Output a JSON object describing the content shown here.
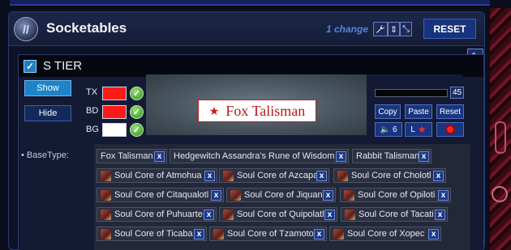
{
  "header": {
    "title": "Socketables",
    "changes": "1 change",
    "reset_label": "RESET"
  },
  "tier": {
    "name": "S TIER",
    "show_label": "Show",
    "hide_label": "Hide"
  },
  "colors": {
    "text_label": "TX",
    "text_color": "#ff1a1a",
    "border_label": "BD",
    "border_color": "#ff1a1a",
    "background_label": "BG",
    "background_color": "#ffffff"
  },
  "preview": {
    "item_name": "Fox Talisman"
  },
  "controls": {
    "font_size": "45",
    "copy_label": "Copy",
    "paste_label": "Paste",
    "reset_label": "Reset",
    "sound_value": "6",
    "minimap_label": "L",
    "sound_icon": "speaker-icon",
    "minimap_icon": "star-icon",
    "beam_icon": "burst-icon"
  },
  "basetype": {
    "label": "BaseType:",
    "items": [
      "Fox Talisman",
      "Hedgewitch Assandra's Rune of Wisdom",
      "Rabbit Talisman",
      "Soul Core of Atmohua",
      "Soul Core of Azcapa",
      "Soul Core of Cholotl",
      "Soul Core of Citaqualotl",
      "Soul Core of Jiquani",
      "Soul Core of Opiloti",
      "Soul Core of Puhuarte",
      "Soul Core of Quipolatl",
      "Soul Core of Tacati",
      "Soul Core of Ticaba",
      "Soul Core of Tzamoto",
      "Soul Core of Xopec"
    ],
    "remove_label": "x"
  }
}
